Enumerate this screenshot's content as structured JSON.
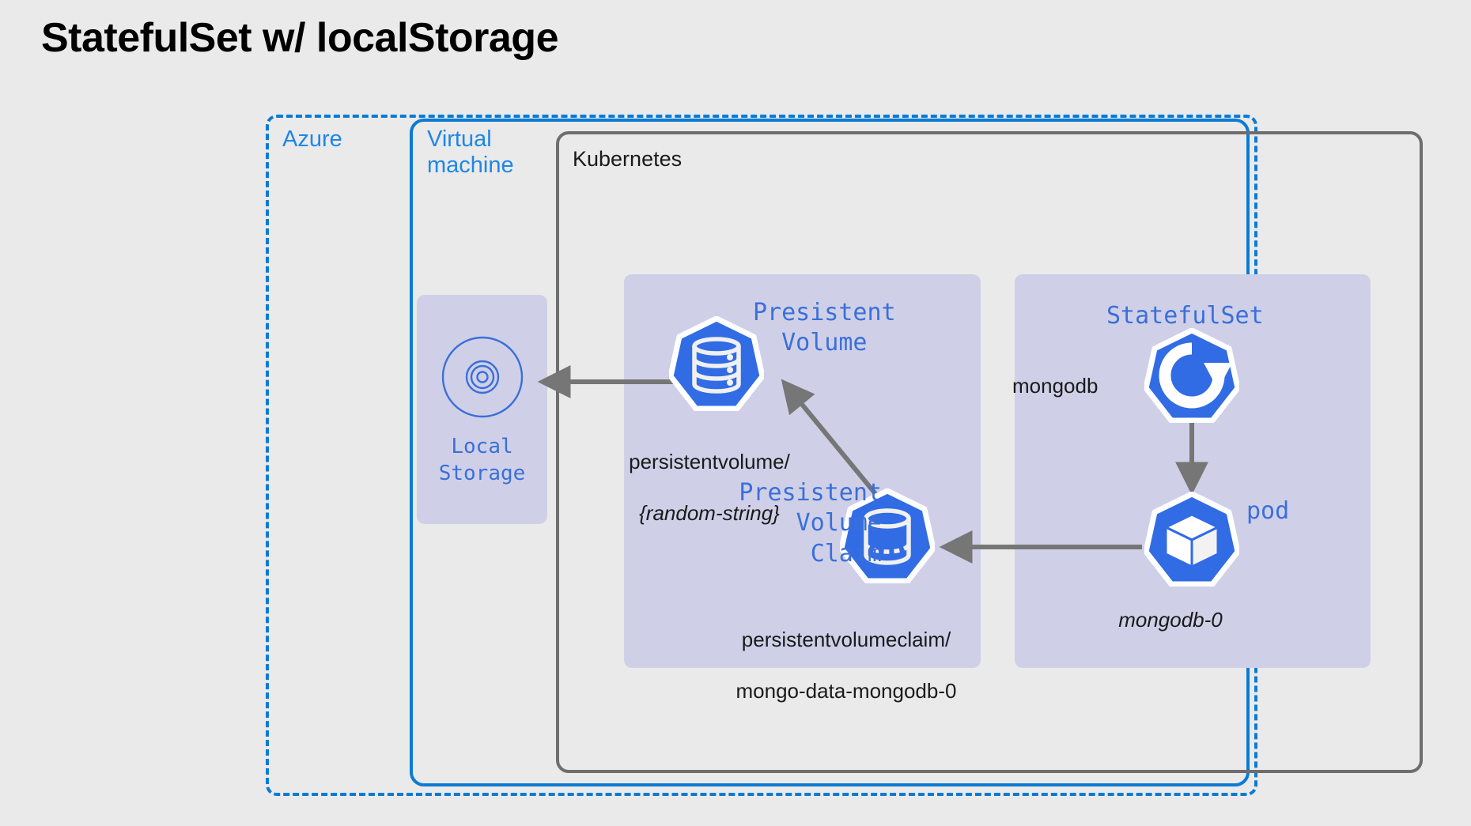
{
  "title": "StatefulSet w/ localStorage",
  "colors": {
    "background": "#eaeaea",
    "azure_blue": "#0a7bd4",
    "label_blue": "#1f86e8",
    "mono_blue": "#3b6fd8",
    "k8s_icon_blue": "#326ce5",
    "panel_lavender": "#cfd0e8",
    "border_gray": "#6e6e6e",
    "arrow_gray": "#767676",
    "text_black": "#1a1a1a"
  },
  "boundaries": {
    "azure": {
      "label": "Azure",
      "style": "dashed"
    },
    "virtual_machine": {
      "label": "Virtual\nmachine",
      "style": "solid"
    },
    "kubernetes": {
      "label": "Kubernetes",
      "style": "solid"
    }
  },
  "nodes": {
    "local_storage": {
      "title": "Local\nStorage",
      "icon": "disc-icon"
    },
    "persistent_volume": {
      "title": "Presistent\nVolume",
      "icon": "database-stack-icon",
      "caption_line1": "persistentvolume/",
      "caption_line2": "{random-string}"
    },
    "persistent_volume_claim": {
      "title": "Presistent\nVolume\nClaim",
      "icon": "volume-claim-cylinder-icon",
      "caption_line1": "persistentvolumeclaim/",
      "caption_line2": "mongo-data-mongodb-0"
    },
    "statefulset": {
      "title": "StatefulSet",
      "icon": "statefulset-rotate-icon",
      "name": "mongodb"
    },
    "pod": {
      "title": "pod",
      "icon": "pod-cube-icon",
      "name": "mongodb-0"
    }
  },
  "connectors": [
    {
      "from": "persistent-volume",
      "to": "local-storage",
      "direction": "left"
    },
    {
      "from": "persistent-volume-claim",
      "to": "persistent-volume",
      "direction": "diagonal-up-left"
    },
    {
      "from": "statefulset",
      "to": "pod",
      "direction": "down"
    },
    {
      "from": "pod",
      "to": "persistent-volume-claim",
      "direction": "left"
    }
  ]
}
